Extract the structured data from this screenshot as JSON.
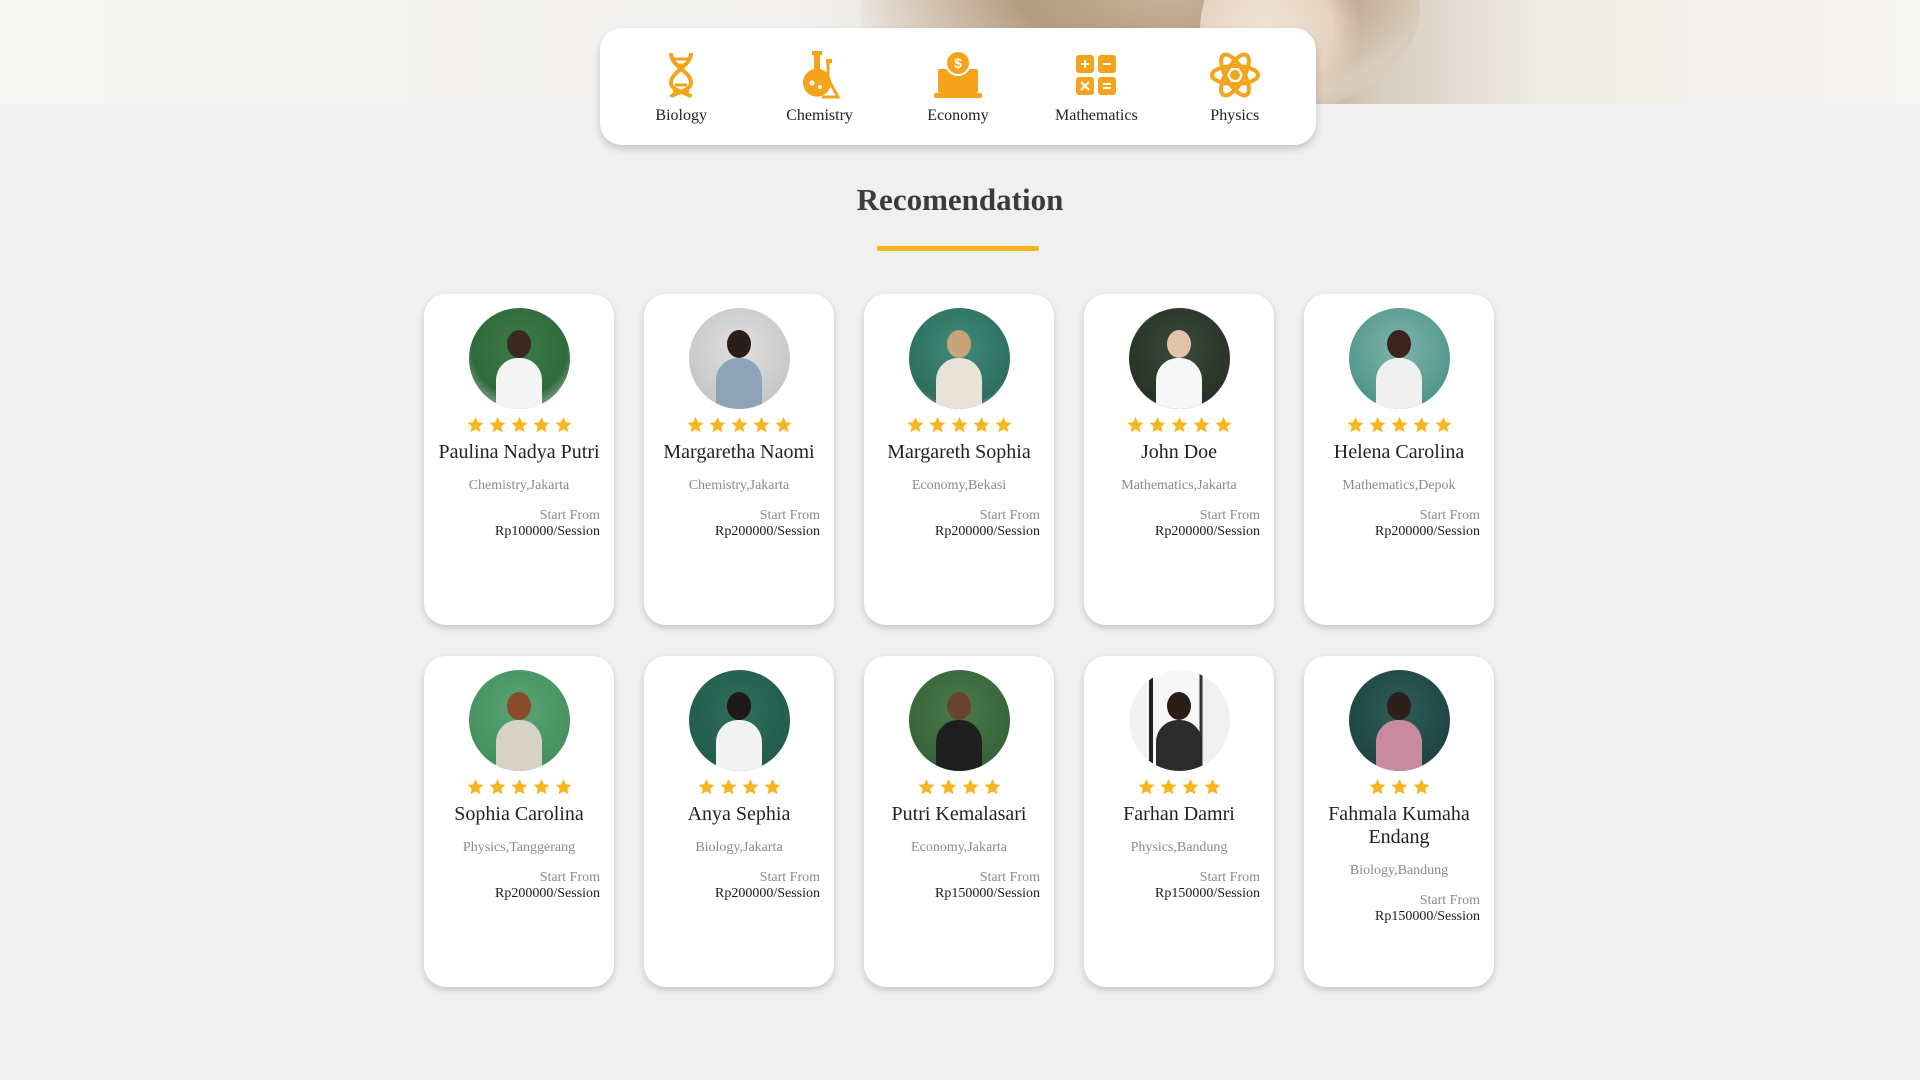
{
  "subjects": [
    {
      "label": "Biology",
      "icon": "dna-icon"
    },
    {
      "label": "Chemistry",
      "icon": "flask-icon"
    },
    {
      "label": "Economy",
      "icon": "money-laptop-icon"
    },
    {
      "label": "Mathematics",
      "icon": "calculator-icon"
    },
    {
      "label": "Physics",
      "icon": "atom-icon"
    }
  ],
  "section": {
    "title": "Recomendation"
  },
  "colors": {
    "accent": "#f2b418",
    "star": "#f7b520",
    "icon": "#f5a31a"
  },
  "tutors": [
    {
      "name": "Paulina Nadya Putri",
      "location": "Chemistry,Jakarta",
      "from_label": "Start From",
      "price": "Rp100000/Session",
      "rating": 5
    },
    {
      "name": "Margaretha Naomi",
      "location": "Chemistry,Jakarta",
      "from_label": "Start From",
      "price": "Rp200000/Session",
      "rating": 5
    },
    {
      "name": "Margareth Sophia",
      "location": "Economy,Bekasi",
      "from_label": "Start From",
      "price": "Rp200000/Session",
      "rating": 5
    },
    {
      "name": "John Doe",
      "location": "Mathematics,Jakarta",
      "from_label": "Start From",
      "price": "Rp200000/Session",
      "rating": 5
    },
    {
      "name": "Helena Carolina",
      "location": "Mathematics,Depok",
      "from_label": "Start From",
      "price": "Rp200000/Session",
      "rating": 5
    },
    {
      "name": "Sophia Carolina",
      "location": "Physics,Tanggerang",
      "from_label": "Start From",
      "price": "Rp200000/Session",
      "rating": 5
    },
    {
      "name": "Anya Sephia",
      "location": "Biology,Jakarta",
      "from_label": "Start From",
      "price": "Rp200000/Session",
      "rating": 4
    },
    {
      "name": "Putri Kemalasari",
      "location": "Economy,Jakarta",
      "from_label": "Start From",
      "price": "Rp150000/Session",
      "rating": 4
    },
    {
      "name": "Farhan Damri",
      "location": "Physics,Bandung",
      "from_label": "Start From",
      "price": "Rp150000/Session",
      "rating": 4
    },
    {
      "name": "Fahmala Kumaha Endang",
      "location": "Biology,Bandung",
      "from_label": "Start From",
      "price": "Rp150000/Session",
      "rating": 3
    }
  ]
}
